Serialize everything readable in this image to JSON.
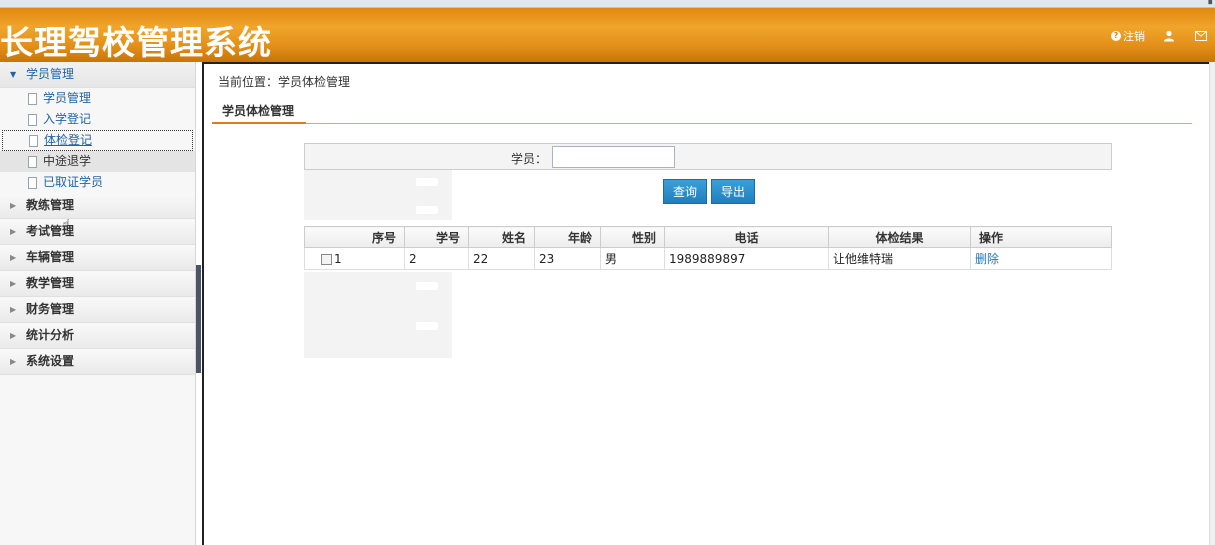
{
  "app": {
    "title": "长理驾校管理系统"
  },
  "header": {
    "logout_label": "注销",
    "user_icon": "user-icon",
    "mail_icon": "mail-icon"
  },
  "sidebar": {
    "groups": [
      {
        "label": "学员管理",
        "open": true,
        "items": [
          {
            "label": "学员管理"
          },
          {
            "label": "入学登记"
          },
          {
            "label": "体检登记",
            "active": true
          },
          {
            "label": "中途退学"
          },
          {
            "label": "已取证学员"
          }
        ]
      },
      {
        "label": "教练管理"
      },
      {
        "label": "考试管理"
      },
      {
        "label": "车辆管理"
      },
      {
        "label": "教学管理"
      },
      {
        "label": "财务管理"
      },
      {
        "label": "统计分析"
      },
      {
        "label": "系统设置"
      }
    ]
  },
  "main": {
    "breadcrumb": "当前位置：学员体检管理",
    "tab_label": "学员体检管理",
    "search": {
      "label": "学员：",
      "value": ""
    },
    "buttons": {
      "query": "查询",
      "export": "导出"
    },
    "table": {
      "headers": [
        "序号",
        "学号",
        "姓名",
        "年龄",
        "性别",
        "电话",
        "体检结果",
        "操作"
      ],
      "rows": [
        {
          "seq": "1",
          "student_no": "2",
          "name": "22",
          "age": "23",
          "gender": "男",
          "phone": "1989889897",
          "result": "让他维特瑞",
          "action": "删除"
        }
      ]
    }
  }
}
